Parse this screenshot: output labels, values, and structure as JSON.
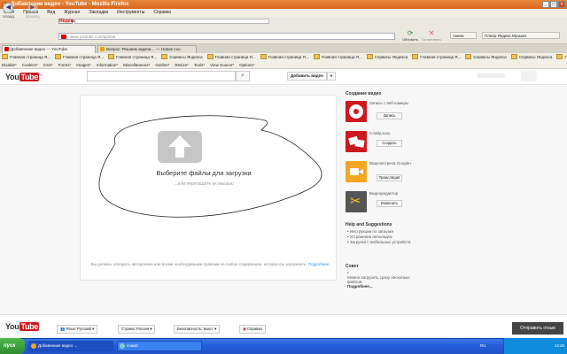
{
  "window": {
    "title": "Добавление видео - YouTube - Mozilla Firefox"
  },
  "menu": [
    "Файл",
    "Правка",
    "Вид",
    "Журнал",
    "Закладки",
    "Инструменты",
    "Справка"
  ],
  "nav": {
    "back": "Назад",
    "forward": "Вперёд",
    "yandex": "Яндекс",
    "url": "www.youtube.com/upload",
    "refresh": "Обновить",
    "stop": "Остановить",
    "home_label": "Акина",
    "right_btn": "Плеер Яндекс.Музыки"
  },
  "tabs": [
    {
      "label": "Добавление видео — YouTube",
      "active": true
    },
    {
      "label": "Вопрос: Решаем задачи… — Новое соо",
      "active": false
    }
  ],
  "bookmarks": [
    "Главная страница Я...",
    "Главная страница Я...",
    "Главная страница Я...",
    "Сервисы Яндекса",
    "Главная страница Я...",
    "Главная страница Я...",
    "Главная страница Я...",
    "Сервисы Яндекса",
    "Главная страница Я...",
    "Сервисы Яндекса",
    "Сервисы Яндекса",
    "Главная страница Я..."
  ],
  "devtools": [
    "Disable*",
    "Cookies*",
    "CSS*",
    "Forms*",
    "Images*",
    "Information*",
    "Miscellaneous*",
    "Outline*",
    "Resize*",
    "Tools*",
    "View Source*",
    "Options*"
  ],
  "yt": {
    "logo_you": "You",
    "logo_tube": "Tube",
    "logo_suffix": "RU",
    "add_video": "Добавить видео",
    "select_files": "Выберите файлы для загрузки",
    "drag_hint": "...или перетащите их мышью",
    "disclaimer": "Вы должны обладать авторскими или всеми необходимыми правами на любое содержание, которое вы загружаете.",
    "disclaimer_link": "Подробнее",
    "create_title": "Создание видео",
    "options": [
      {
        "label": "Запись с веб-камеры",
        "button": "Запись",
        "color": "#cc181e"
      },
      {
        "label": "Слайд-шоу",
        "button": "Создать",
        "color": "#cc181e"
      },
      {
        "label": "Видеовстреча Google+",
        "button": "Трансляция",
        "color": "#f5a623"
      },
      {
        "label": "Видеоредактор",
        "button": "Изменить",
        "color": "#555555"
      }
    ],
    "help_title": "Help and Suggestions",
    "help_items": [
      "Инструкции по загрузке",
      "Устранение неполадок",
      "Загрузка с мобильных устройств"
    ],
    "tip_title": "Совет",
    "tip_text": "Можно загрузить сразу несколько файлов.",
    "tip_more": "Подробнее..."
  },
  "footer": {
    "language": "Язык: Русский",
    "country": "Страна: Россия",
    "safety": "Безопасность: выкл.",
    "help": "Справка",
    "feedback": "Отправить отзыв"
  },
  "taskbar": {
    "start": "пуск",
    "items": [
      "Добавление видео ...",
      "сним2"
    ],
    "lang": "RU",
    "clock": "14:26"
  }
}
